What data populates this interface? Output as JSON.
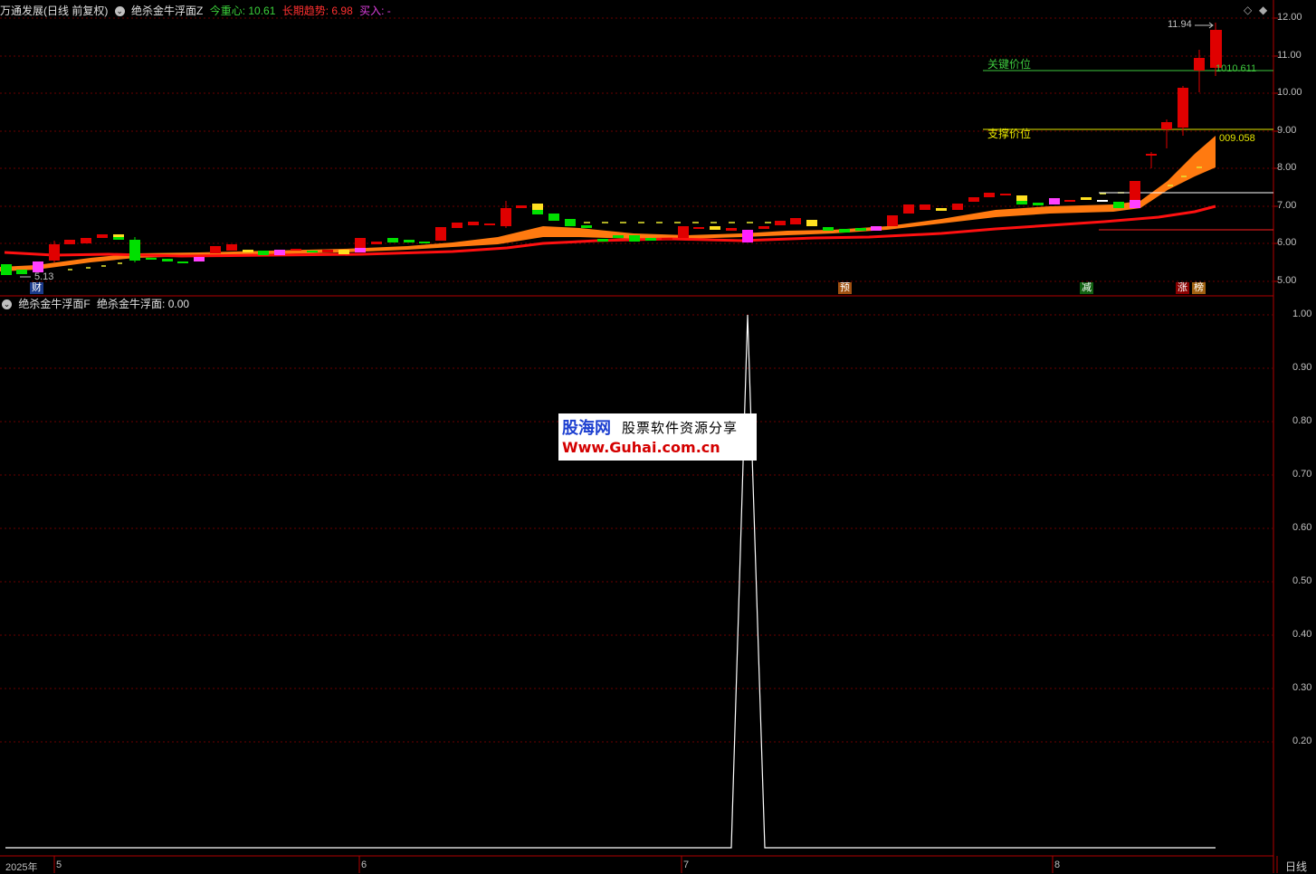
{
  "header": {
    "stock": "万通发展(日线 前复权)",
    "indicator": "绝杀金牛浮面Z",
    "center_label": "今重心: 10.61",
    "trend_label": "长期趋势: 6.98",
    "buy_label": "买入: -"
  },
  "sub_header": {
    "indicator": "绝杀金牛浮面F",
    "value_label": "绝杀金牛浮面: 0.00"
  },
  "price_axis": [
    "12.00",
    "11.00",
    "10.00",
    "9.00",
    "8.00",
    "7.00",
    "6.00",
    "5.00"
  ],
  "sub_axis": [
    "1.00",
    "0.90",
    "0.80",
    "0.70",
    "0.60",
    "0.50",
    "0.40",
    "0.30",
    "0.20"
  ],
  "annotations": {
    "high": "11.94",
    "low": "5.13",
    "key_level_label": "关键价位",
    "key_level_value": "1010.611",
    "support_label": "支撑价位",
    "support_value": "009.058"
  },
  "markers": [
    "财",
    "预",
    "减",
    "涨",
    "榜"
  ],
  "x_axis": {
    "year": "2025年",
    "months": [
      "5",
      "6",
      "7",
      "8"
    ],
    "period_tab": "日线"
  },
  "watermark": {
    "brand": "股海网",
    "slogan": "股票软件资源分享",
    "url": "Www.Guhai.com.cn"
  },
  "colors": {
    "up": "#e00000",
    "down": "#00e000",
    "band": "#ff7a10",
    "trend": "#ff1010",
    "key_line": "#3ec93e",
    "support_line": "#e6e600",
    "grid": "#8b0000"
  },
  "chart_data": {
    "type": "line",
    "title": "绝杀金牛浮面",
    "ylim": [
      0,
      1
    ],
    "signal_peak": 1.0,
    "current": 0.0
  }
}
